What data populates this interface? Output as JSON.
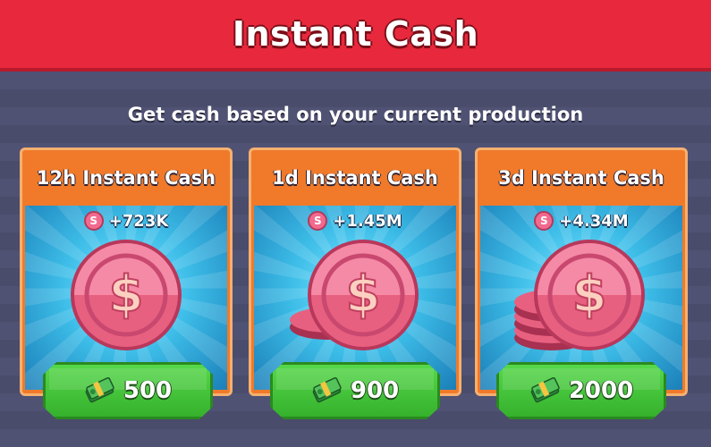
{
  "header": {
    "title": "Instant Cash"
  },
  "subtitle": "Get cash based on your current production",
  "icons": {
    "coin": "pink-coin-icon",
    "cash": "cash-bundle-icon"
  },
  "colors": {
    "header": "#e8283c",
    "card": "#f07a2a",
    "button": "#36b12d",
    "coin": "#f26a8f"
  },
  "offers": [
    {
      "title": "12h Instant Cash",
      "amount": "+723K",
      "price": "500"
    },
    {
      "title": "1d Instant Cash",
      "amount": "+1.45M",
      "price": "900"
    },
    {
      "title": "3d Instant Cash",
      "amount": "+4.34M",
      "price": "2000"
    }
  ]
}
